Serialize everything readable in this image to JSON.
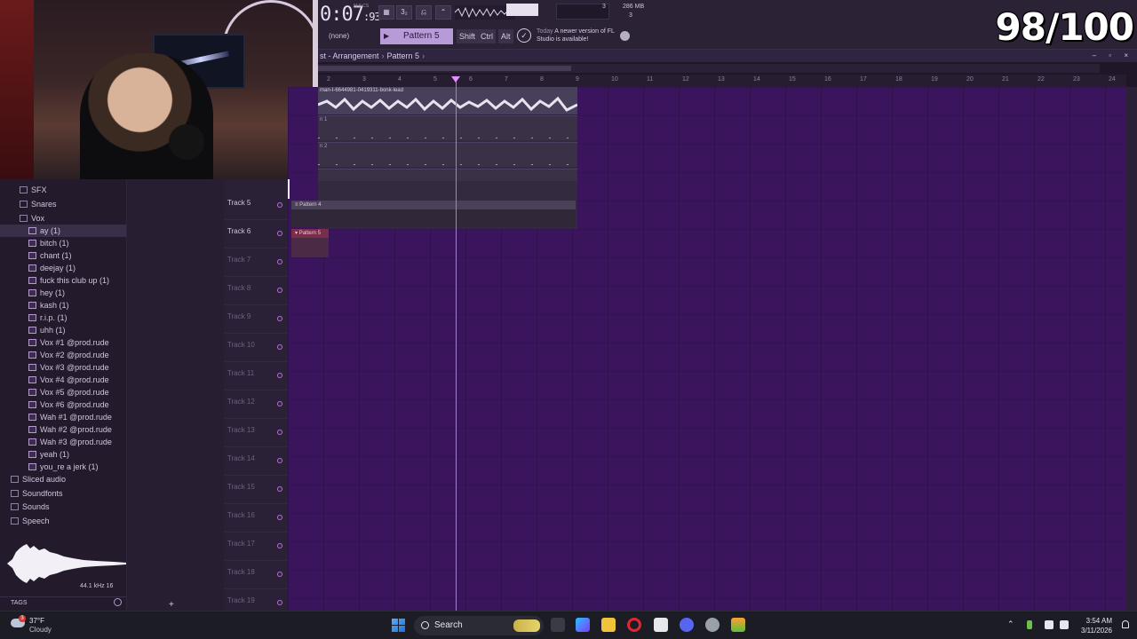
{
  "toolbar": {
    "time_main": "0:07",
    "time_frac": ":93",
    "time_label": "M:S:CS",
    "buttons": [
      "▦",
      "3₂",
      "⎌",
      "⌃"
    ],
    "num1": "3",
    "num2": "3",
    "memory": "286 MB",
    "snap": "(none)",
    "pattern": "Pattern 5",
    "shift_label": "Shift",
    "ctrl_label": "Ctrl",
    "alt_label": "Alt",
    "news_today": "Today",
    "news_text": "A newer version of FL Studio is available!"
  },
  "overlay": {
    "score": "98/100"
  },
  "playlist": {
    "breadcrumb": [
      "st - Arrangement",
      "Pattern 5"
    ],
    "window_controls": "– ▫ ×",
    "ruler": [
      "2",
      "3",
      "4",
      "5",
      "6",
      "7",
      "8",
      "9",
      "10",
      "11",
      "12",
      "13",
      "14",
      "15",
      "16",
      "17",
      "18",
      "19",
      "20",
      "21",
      "22",
      "23",
      "24"
    ],
    "audio_clip_label": "man-I-6644981-0419311-bonk-lead",
    "clip_labels": [
      "n 1",
      "n 2"
    ],
    "pattern4_label": "Pattern 4",
    "pattern5_label": "Pattern 5",
    "tracks": [
      "Track 5",
      "Track 6",
      "Track 7",
      "Track 8",
      "Track 9",
      "Track 10",
      "Track 11",
      "Track 12",
      "Track 13",
      "Track 14",
      "Track 15",
      "Track 16",
      "Track 17",
      "Track 18",
      "Track 19"
    ]
  },
  "browser": {
    "folders": [
      "SFX",
      "Snares",
      "Vox"
    ],
    "files": [
      "ay (1)",
      "bitch (1)",
      "chant (1)",
      "deejay (1)",
      "fuck this club up (1)",
      "hey (1)",
      "kash (1)",
      "r.i.p. (1)",
      "uhh (1)",
      "Vox #1 @prod.rude",
      "Vox #2 @prod.rude",
      "Vox #3 @prod.rude",
      "Vox #4 @prod.rude",
      "Vox #5 @prod.rude",
      "Vox #6 @prod.rude",
      "Wah #1 @prod.rude",
      "Wah #2 @prod.rude",
      "Wah #3 @prod.rude",
      "yeah (1)",
      "you_re a jerk (1)"
    ],
    "bottom_folders": [
      "Sliced audio",
      "Soundfonts",
      "Sounds",
      "Speech"
    ],
    "wave_info": "44.1 kHz 16",
    "tags_label": "TAGS"
  },
  "taskbar": {
    "weather_temp": "37°F",
    "weather_desc": "Cloudy",
    "weather_badge": "3",
    "search_label": "Search",
    "time": "3:54 AM",
    "date": "3/11/2026"
  }
}
